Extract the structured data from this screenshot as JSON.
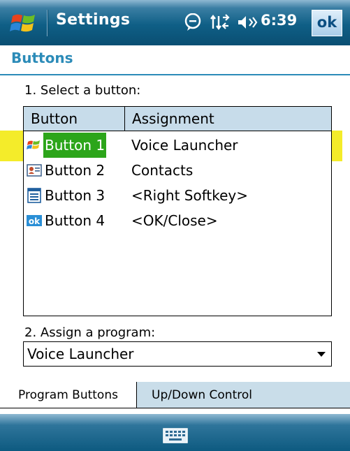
{
  "titlebar": {
    "title": "Settings",
    "time": "6:39",
    "ok_label": "ok",
    "icons": [
      "windows-flag-icon",
      "notification-icon",
      "connectivity-icon",
      "volume-icon"
    ]
  },
  "page": {
    "heading": "Buttons",
    "step1_label": "1. Select a button:",
    "step2_label": "2. Assign a program:"
  },
  "list": {
    "columns": [
      "Button",
      "Assignment"
    ],
    "rows": [
      {
        "button": "Button 1",
        "assignment": "Voice Launcher",
        "icon": "windows-flag-icon",
        "selected": true
      },
      {
        "button": "Button 2",
        "assignment": "Contacts",
        "icon": "contacts-card-icon",
        "selected": false
      },
      {
        "button": "Button 3",
        "assignment": "<Right Softkey>",
        "icon": "softkey-icon",
        "selected": false
      },
      {
        "button": "Button 4",
        "assignment": "<OK/Close>",
        "icon": "ok-icon",
        "selected": false
      }
    ]
  },
  "program_select": {
    "value": "Voice Launcher"
  },
  "tabs": [
    "Program Buttons",
    "Up/Down Control"
  ],
  "bottombar": {
    "icon": "keyboard-icon"
  },
  "colors": {
    "titlebar": "#0f5f86",
    "heading": "#2b8bb8",
    "highlight": "#f4ec2a",
    "selection": "#2ca51a",
    "header_bg": "#c7dcea"
  }
}
